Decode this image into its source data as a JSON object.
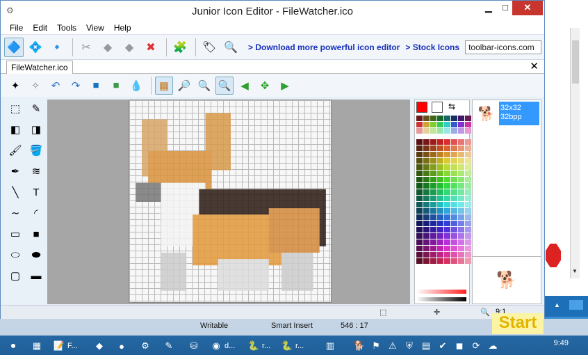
{
  "window": {
    "title": "Junior Icon Editor - FileWatcher.ico",
    "min_label": "▁",
    "max_label": "□",
    "close_label": "✕"
  },
  "menu": [
    "File",
    "Edit",
    "Tools",
    "View",
    "Help"
  ],
  "toolbar": {
    "download_link": "> Download more powerful icon editor",
    "stock_link": "> Stock Icons",
    "site_value": "toolbar-icons.com"
  },
  "doc_tab": {
    "label": "FileWatcher.ico",
    "close": "✕"
  },
  "formats": [
    {
      "size": "32x32",
      "depth": "32bpp"
    }
  ],
  "palette": {
    "primary": "#ff0000",
    "secondary": "#ffffff"
  },
  "status": {
    "mode": "Writable",
    "insert": "Smart Insert",
    "coords": "546 : 17",
    "zoom": "9:1"
  },
  "start_label": "Start",
  "taskbar": {
    "items": [
      {
        "label": "F...",
        "icon": "notepad-icon"
      },
      {
        "label": "d...",
        "icon": "app-icon"
      },
      {
        "label": "r...",
        "icon": "python-icon"
      },
      {
        "label": "r...",
        "icon": "python-icon"
      }
    ],
    "time": "9:49"
  },
  "colors": {
    "accent": "#3399ff",
    "close_red": "#c7362e",
    "link": "#1530b8"
  }
}
